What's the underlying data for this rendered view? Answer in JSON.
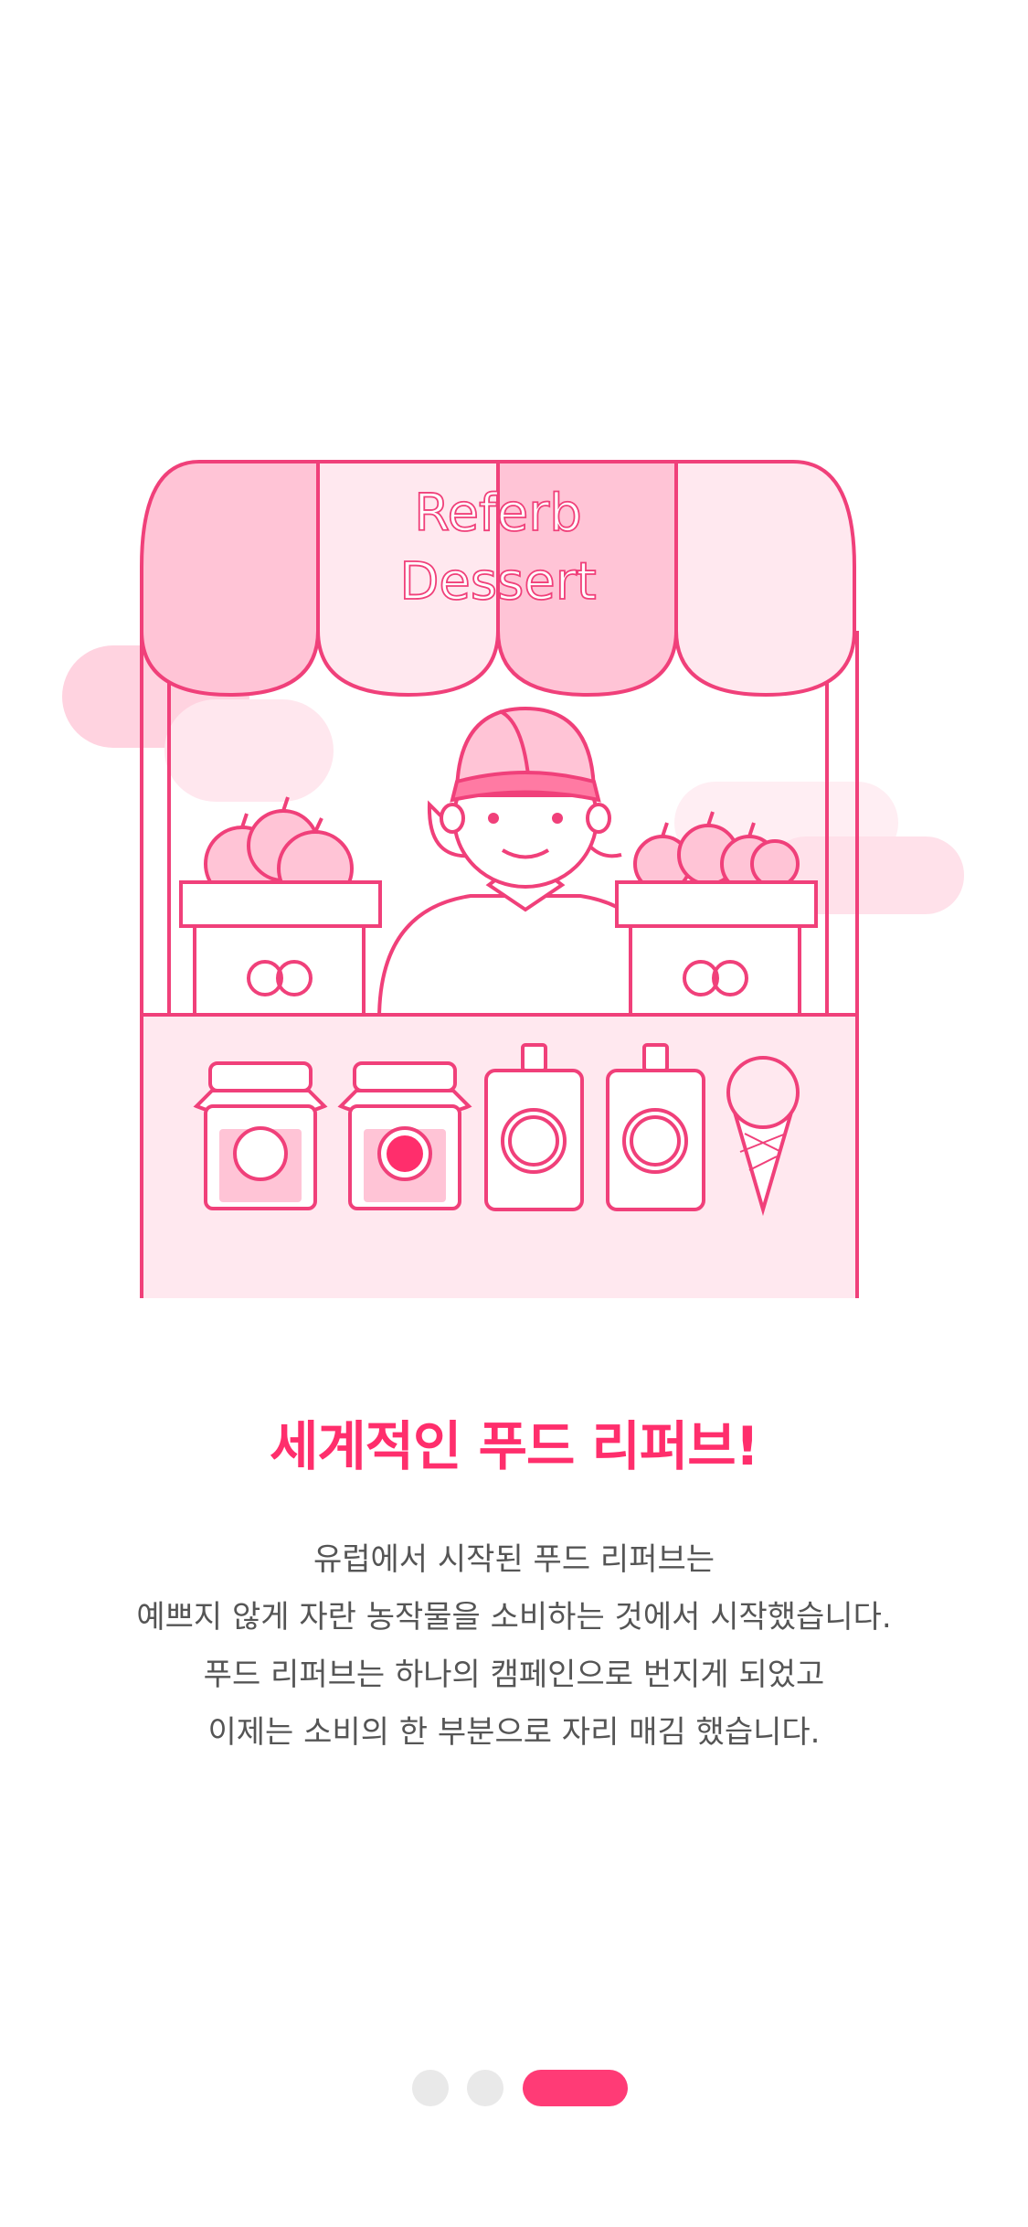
{
  "illustration": {
    "awning_text_line1": "Referb",
    "awning_text_line2": "Dessert"
  },
  "onboarding": {
    "title": "세계적인 푸드 리퍼브!",
    "description_lines": [
      "유럽에서 시작된 푸드 리퍼브는",
      "예쁘지 않게 자란 농작물을 소비하는 것에서 시작했습니다.",
      "푸드 리퍼브는 하나의 캠페인으로 번지게 되었고",
      "이제는 소비의 한 부분으로 자리 매김 했습니다."
    ]
  },
  "pager": {
    "total": 3,
    "current_page": 3
  },
  "colors": {
    "accent": "#ff2e6c",
    "indicator_active": "#ff3b76",
    "indicator_inactive": "#e9e9e9",
    "line": "#f0407a",
    "pink_light": "#ffe8ef",
    "pink_mid": "#ffc4d6"
  }
}
